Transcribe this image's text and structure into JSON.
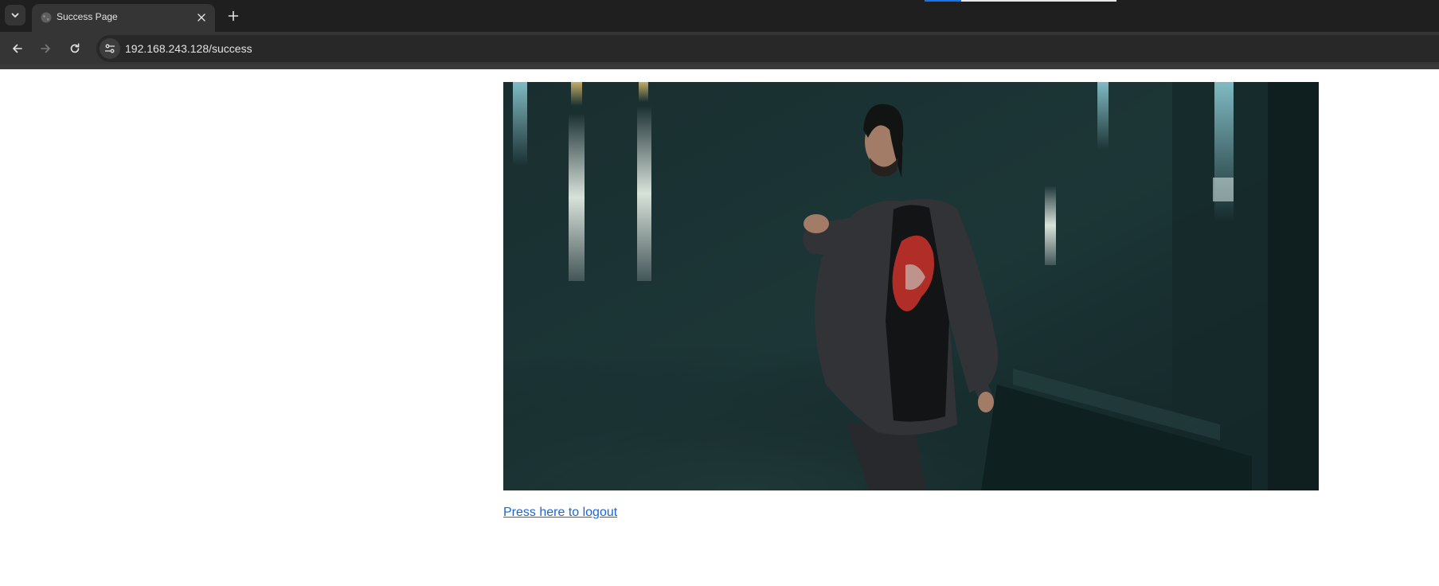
{
  "browser": {
    "tab": {
      "title": "Success Page",
      "favicon": "globe-icon"
    },
    "toolbar": {
      "url": "192.168.243.128/success",
      "back_icon": "arrow-left-icon",
      "forward_icon": "arrow-right-icon",
      "reload_icon": "reload-icon",
      "site_info_icon": "tune-icon"
    }
  },
  "page": {
    "image": {
      "subject": "man in dark suit pointing forward on stage"
    },
    "logout_link": "Press here to logout"
  },
  "colors": {
    "tabstrip_bg": "#1f1f1f",
    "toolbar_bg": "#353535",
    "omnibox_bg": "#282828",
    "link": "#1a66d6"
  }
}
